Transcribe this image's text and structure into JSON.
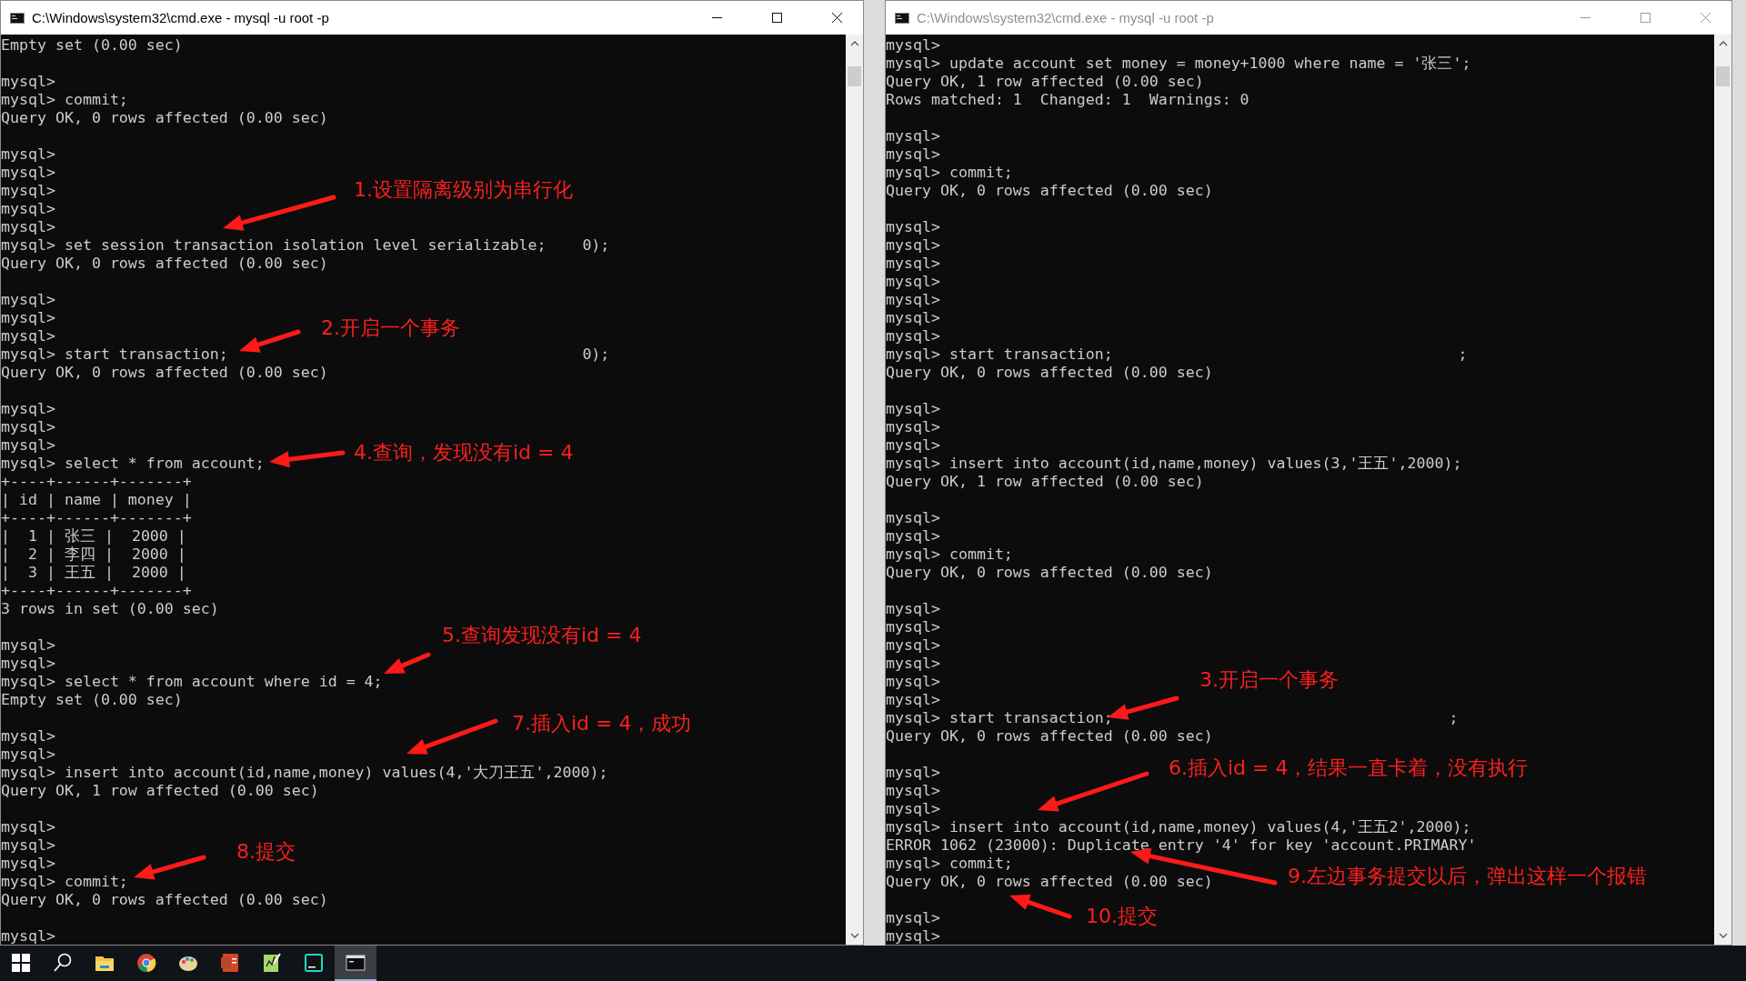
{
  "windows": [
    {
      "title": "C:\\Windows\\system32\\cmd.exe - mysql  -u root -p",
      "active": true,
      "blocks": [
        [
          "Empty set (0.00 sec)"
        ],
        [
          "mysql>",
          "mysql> commit;",
          "Query OK, 0 rows affected (0.00 sec)"
        ],
        [
          "mysql>",
          "mysql>",
          "mysql>",
          "mysql>",
          "mysql>",
          "mysql> set session transaction isolation level serializable;    0);",
          "Query OK, 0 rows affected (0.00 sec)"
        ],
        [
          "mysql>",
          "mysql>",
          "mysql>",
          "mysql> start transaction;                                       0);",
          "Query OK, 0 rows affected (0.00 sec)"
        ],
        [
          "mysql>",
          "mysql>",
          "mysql>",
          "mysql> select * from account;",
          "+----+------+-------+",
          "| id | name | money |",
          "+----+------+-------+",
          "|  1 | 张三 |  2000 |",
          "|  2 | 李四 |  2000 |",
          "|  3 | 王五 |  2000 |",
          "+----+------+-------+",
          "3 rows in set (0.00 sec)"
        ],
        [
          "mysql>",
          "mysql>",
          "mysql> select * from account where id = 4;",
          "Empty set (0.00 sec)"
        ],
        [
          "mysql>",
          "mysql>",
          "mysql> insert into account(id,name,money) values(4,'大刀王五',2000);",
          "Query OK, 1 row affected (0.00 sec)"
        ],
        [
          "mysql>",
          "mysql>",
          "mysql>",
          "mysql> commit;",
          "Query OK, 0 rows affected (0.00 sec)"
        ],
        [
          "mysql>"
        ]
      ]
    },
    {
      "title": "C:\\Windows\\system32\\cmd.exe - mysql  -u root -p",
      "active": false,
      "blocks": [
        [
          "mysql>",
          "mysql> update account set money = money+1000 where name = '张三';",
          "Query OK, 1 row affected (0.00 sec)",
          "Rows matched: 1  Changed: 1  Warnings: 0"
        ],
        [
          "mysql>",
          "mysql>",
          "mysql> commit;",
          "Query OK, 0 rows affected (0.00 sec)"
        ],
        [
          "mysql>",
          "mysql>",
          "mysql>",
          "mysql>",
          "mysql>",
          "mysql>",
          "mysql>",
          "mysql> start transaction;                                      ;",
          "Query OK, 0 rows affected (0.00 sec)"
        ],
        [
          "mysql>",
          "mysql>",
          "mysql>",
          "mysql> insert into account(id,name,money) values(3,'王五',2000);",
          "Query OK, 1 row affected (0.00 sec)"
        ],
        [
          "mysql>",
          "mysql>",
          "mysql> commit;",
          "Query OK, 0 rows affected (0.00 sec)"
        ],
        [
          "mysql>",
          "mysql>",
          "mysql>",
          "mysql>",
          "mysql>",
          "mysql>",
          "mysql> start transaction;                                     ;",
          "Query OK, 0 rows affected (0.00 sec)"
        ],
        [
          "mysql>",
          "mysql>",
          "mysql>",
          "mysql> insert into account(id,name,money) values(4,'王五2',2000);",
          "ERROR 1062 (23000): Duplicate entry '4' for key 'account.PRIMARY'",
          "mysql> commit;",
          "Query OK, 0 rows affected (0.00 sec)"
        ],
        [
          "mysql>",
          "mysql>"
        ]
      ]
    }
  ],
  "annotations": [
    {
      "text": "1.设置隔离级别为串行化"
    },
    {
      "text": "2.开启一个事务"
    },
    {
      "text": "4.查询，发现没有id = 4"
    },
    {
      "text": "5.查询发现没有id = 4"
    },
    {
      "text": "7.插入id = 4，成功"
    },
    {
      "text": "8.提交"
    },
    {
      "text": "3.开启一个事务"
    },
    {
      "text": "6.插入id = 4，结果一直卡着，没有执行"
    },
    {
      "text": "9.左边事务提交以后，弹出这样一个报错"
    },
    {
      "text": "10.提交"
    }
  ],
  "taskbar": {
    "items": [
      {
        "kind": "start",
        "selected": false
      },
      {
        "kind": "search",
        "selected": false
      },
      {
        "kind": "folder",
        "selected": false
      },
      {
        "kind": "browser",
        "selected": false
      },
      {
        "kind": "paint",
        "selected": false
      },
      {
        "kind": "slides",
        "selected": false
      },
      {
        "kind": "notes",
        "selected": false
      },
      {
        "kind": "database",
        "selected": false
      },
      {
        "kind": "terminal",
        "selected": true
      }
    ]
  }
}
